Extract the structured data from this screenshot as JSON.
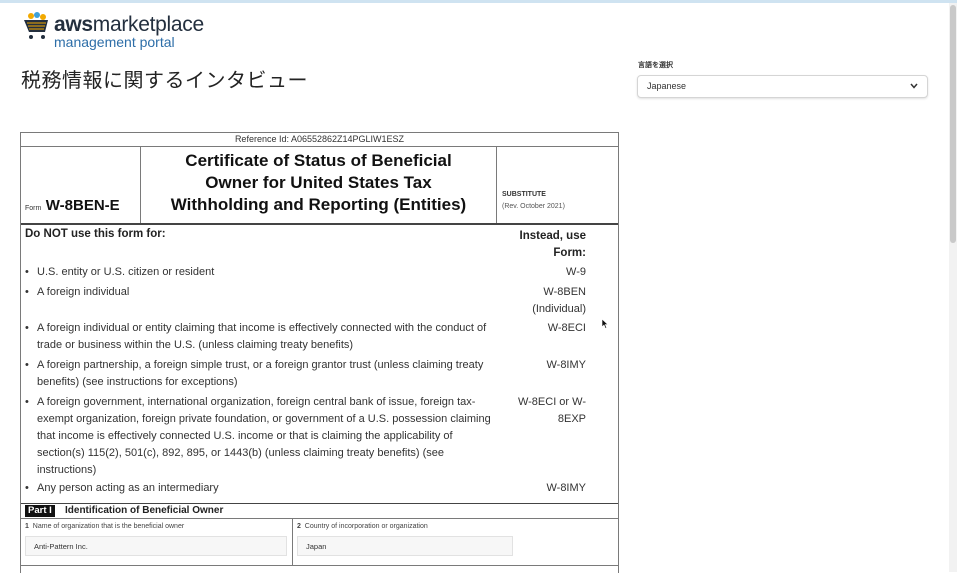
{
  "logo": {
    "brand_aws": "aws",
    "brand_rest": "marketplace",
    "subtitle": "management portal"
  },
  "page_title": "税務情報に関するインタビュー",
  "language": {
    "label": "言語を選択",
    "selected": "Japanese"
  },
  "form": {
    "reference_id": "Reference Id: A06552862Z14PGLIW1ESZ",
    "form_prefix": "Form",
    "form_name": "W-8BEN-E",
    "title_lines": [
      "Certificate of Status of Beneficial",
      "Owner for United States Tax",
      "Withholding and Reporting (Entities)"
    ],
    "substitute": "SUBSTITUTE",
    "revision": "(Rev. October 2021)",
    "do_not_use": "Do NOT use this form for:",
    "instead_header": "Instead, use Form:",
    "rows": [
      {
        "text": "U.S. entity or U.S. citizen or resident",
        "form": "W-9"
      },
      {
        "text": "A foreign individual",
        "form": "W-8BEN (Individual)"
      },
      {
        "text": "A foreign individual or entity claiming that income is effectively connected with the conduct of trade or business within the U.S. (unless claiming treaty benefits)",
        "form": "W-8ECI"
      },
      {
        "text": "A foreign partnership, a foreign simple trust, or a foreign grantor trust (unless claiming treaty benefits) (see instructions for exceptions)",
        "form": "W-8IMY"
      },
      {
        "text": "A foreign government, international organization, foreign central bank of issue, foreign tax-exempt organization, foreign private foundation, or government of a U.S. possession claiming that income is effectively connected U.S. income or that is claiming the applicability of section(s) 115(2), 501(c), 892, 895, or 1443(b) (unless claiming treaty benefits) (see instructions)",
        "form": "W-8ECI or W-8EXP"
      },
      {
        "text": "Any person acting as an intermediary",
        "form": "W-8IMY"
      }
    ],
    "part_badge": "Part I",
    "part_title": "Identification of Beneficial Owner",
    "field1": {
      "num": "1",
      "label": "Name of organization that is the beneficial owner",
      "value": "Anti-Pattern Inc."
    },
    "field2": {
      "num": "2",
      "label": "Country of incorporation or organization",
      "value": "Japan"
    }
  },
  "icons": {
    "logo": "cart-icon",
    "select": "chevron-down-icon",
    "cursor": "mouse-pointer-icon"
  }
}
